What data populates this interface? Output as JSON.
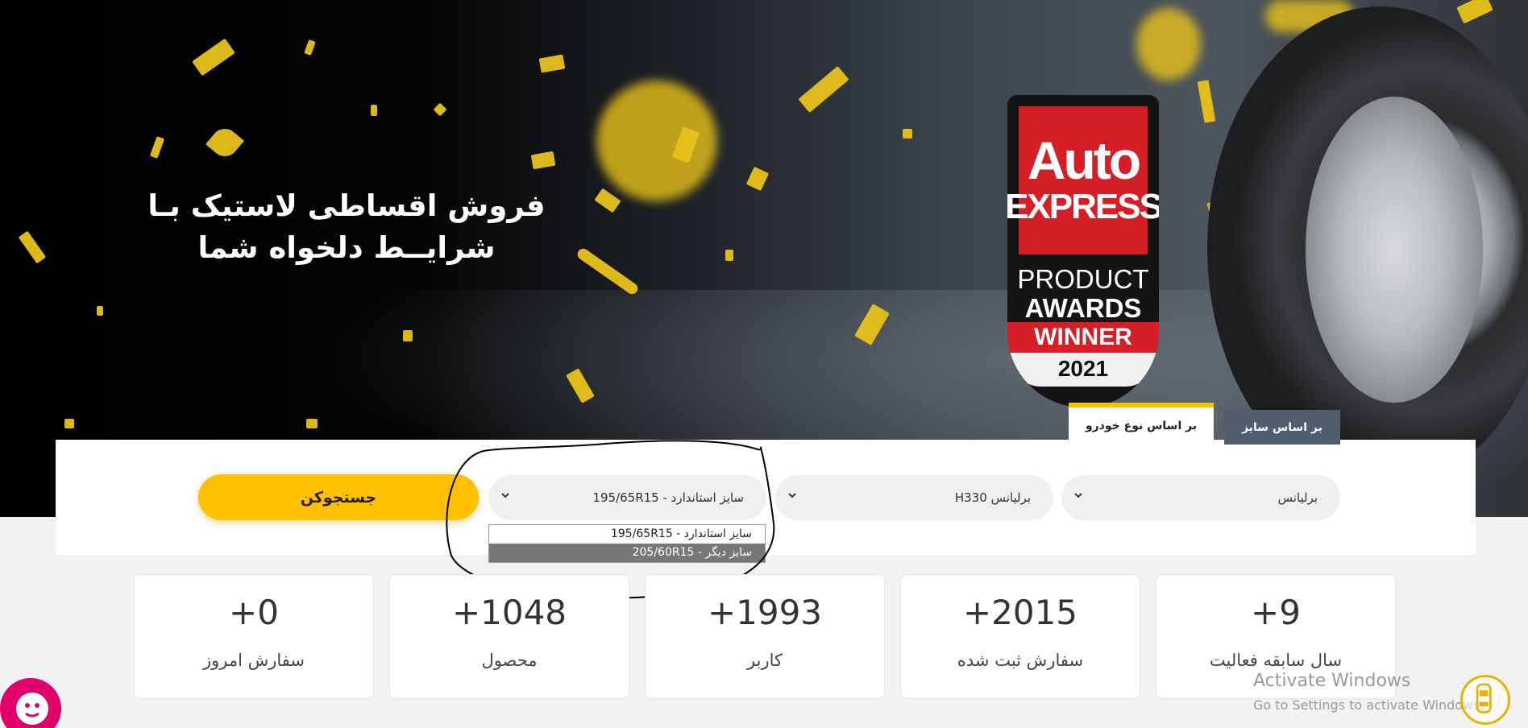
{
  "hero": {
    "headline_line1": "فروش اقساطی لاستیک بـا",
    "headline_line2": "شرایــط دلخواه شما"
  },
  "award": {
    "brand_top": "Auto",
    "brand_bottom": "EXPRESS",
    "product": "PRODUCT",
    "awards": "AWARDS",
    "winner": "WINNER",
    "year": "2021"
  },
  "tabs": {
    "by_car": "بر اساس نوع خودرو",
    "by_size": "بر اساس سایز",
    "active": "by_car"
  },
  "search": {
    "brand_value": "برلیانس",
    "model_value": "برلیانس H330",
    "size_value": "سایز استاندارد - 195/65R15",
    "button_label": "جستجوکن",
    "size_options": [
      "سایز استاندارد - 195/65R15",
      "سایز دیگر - 205/60R15"
    ],
    "highlighted_option_index": 1
  },
  "stats": [
    {
      "value": "+0",
      "label": "سفارش امروز"
    },
    {
      "value": "+1048",
      "label": "محصول"
    },
    {
      "value": "+1993",
      "label": "کاربر"
    },
    {
      "value": "+2015",
      "label": "سفارش ثبت شده"
    },
    {
      "value": "+9",
      "label": "سال سابقه فعالیت"
    }
  ],
  "windows_watermark": {
    "title": "Activate Windows",
    "subtitle": "Go to Settings to activate Windows."
  },
  "colors": {
    "accent": "#ffc000",
    "tab_active_border": "#f8c100",
    "tab_inactive": "#4f5d6e",
    "chat_button": "#e1006a",
    "award_red": "#d61e26"
  }
}
